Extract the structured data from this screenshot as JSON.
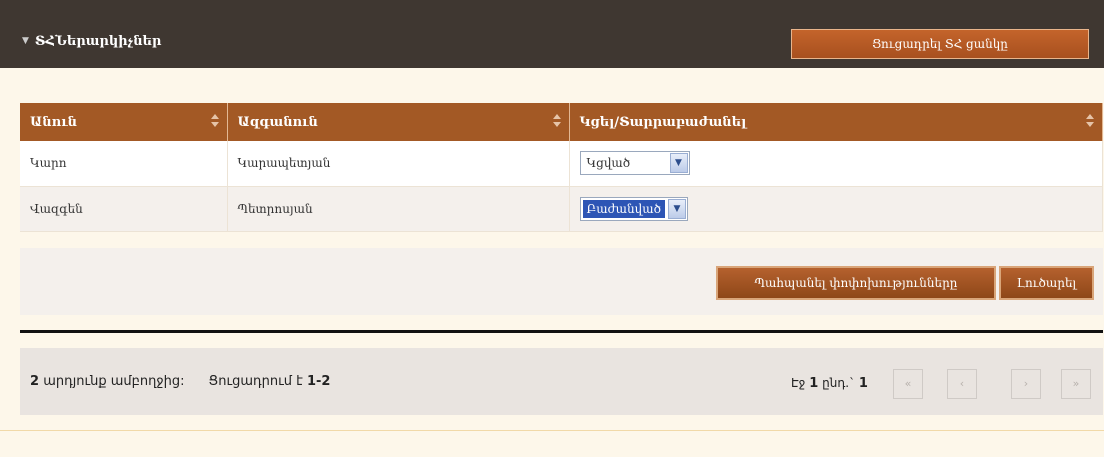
{
  "header": {
    "title": "ՏՀՆերարկիչներ",
    "show_list_button": "Ցուցադրել ՏՀ ցանկը"
  },
  "table": {
    "columns": [
      "Անուն",
      "Ազգանուն",
      "Կցել/Տարրաբաժանել"
    ],
    "rows": [
      {
        "first_name": "Կարո",
        "last_name": "Կարապետյան",
        "status": "Կցված"
      },
      {
        "first_name": "Վազգեն",
        "last_name": "Պետրոսյան",
        "status": "Բաժանված"
      }
    ]
  },
  "actions": {
    "save_label": "Պահպանել փոփոխությունները",
    "cancel_label": "Լուծարել"
  },
  "pager": {
    "total_prefix": "2",
    "total_text": "արդյունք ամբողջից:",
    "showing_text": "Ցուցադրում է",
    "showing_range": "1-2",
    "page_label": "Էջ",
    "page_current": "1",
    "page_of": "ընդ.`",
    "page_total": "1",
    "first": "«",
    "prev": "‹",
    "next": "›",
    "last": "»"
  },
  "colors": {
    "header_bg": "#3f3731",
    "accent": "#a35925",
    "page_bg": "#fdf7ea"
  }
}
